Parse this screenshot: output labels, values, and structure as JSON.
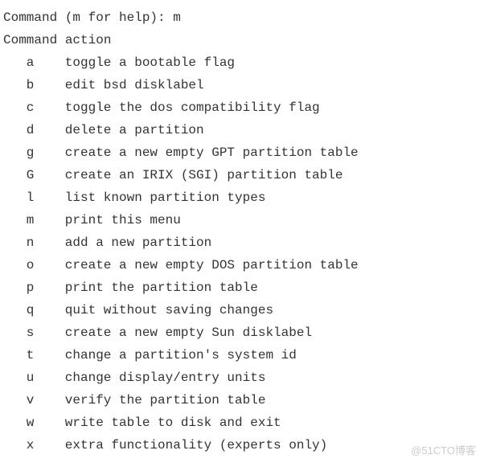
{
  "prompt": {
    "label": "Command (m for help): ",
    "input": "m"
  },
  "header": "Command action",
  "commands": [
    {
      "key": "a",
      "desc": "toggle a bootable flag"
    },
    {
      "key": "b",
      "desc": "edit bsd disklabel"
    },
    {
      "key": "c",
      "desc": "toggle the dos compatibility flag"
    },
    {
      "key": "d",
      "desc": "delete a partition"
    },
    {
      "key": "g",
      "desc": "create a new empty GPT partition table"
    },
    {
      "key": "G",
      "desc": "create an IRIX (SGI) partition table"
    },
    {
      "key": "l",
      "desc": "list known partition types"
    },
    {
      "key": "m",
      "desc": "print this menu"
    },
    {
      "key": "n",
      "desc": "add a new partition"
    },
    {
      "key": "o",
      "desc": "create a new empty DOS partition table"
    },
    {
      "key": "p",
      "desc": "print the partition table"
    },
    {
      "key": "q",
      "desc": "quit without saving changes"
    },
    {
      "key": "s",
      "desc": "create a new empty Sun disklabel"
    },
    {
      "key": "t",
      "desc": "change a partition's system id"
    },
    {
      "key": "u",
      "desc": "change display/entry units"
    },
    {
      "key": "v",
      "desc": "verify the partition table"
    },
    {
      "key": "w",
      "desc": "write table to disk and exit"
    },
    {
      "key": "x",
      "desc": "extra functionality (experts only)"
    }
  ],
  "watermark": "@51CTO博客"
}
